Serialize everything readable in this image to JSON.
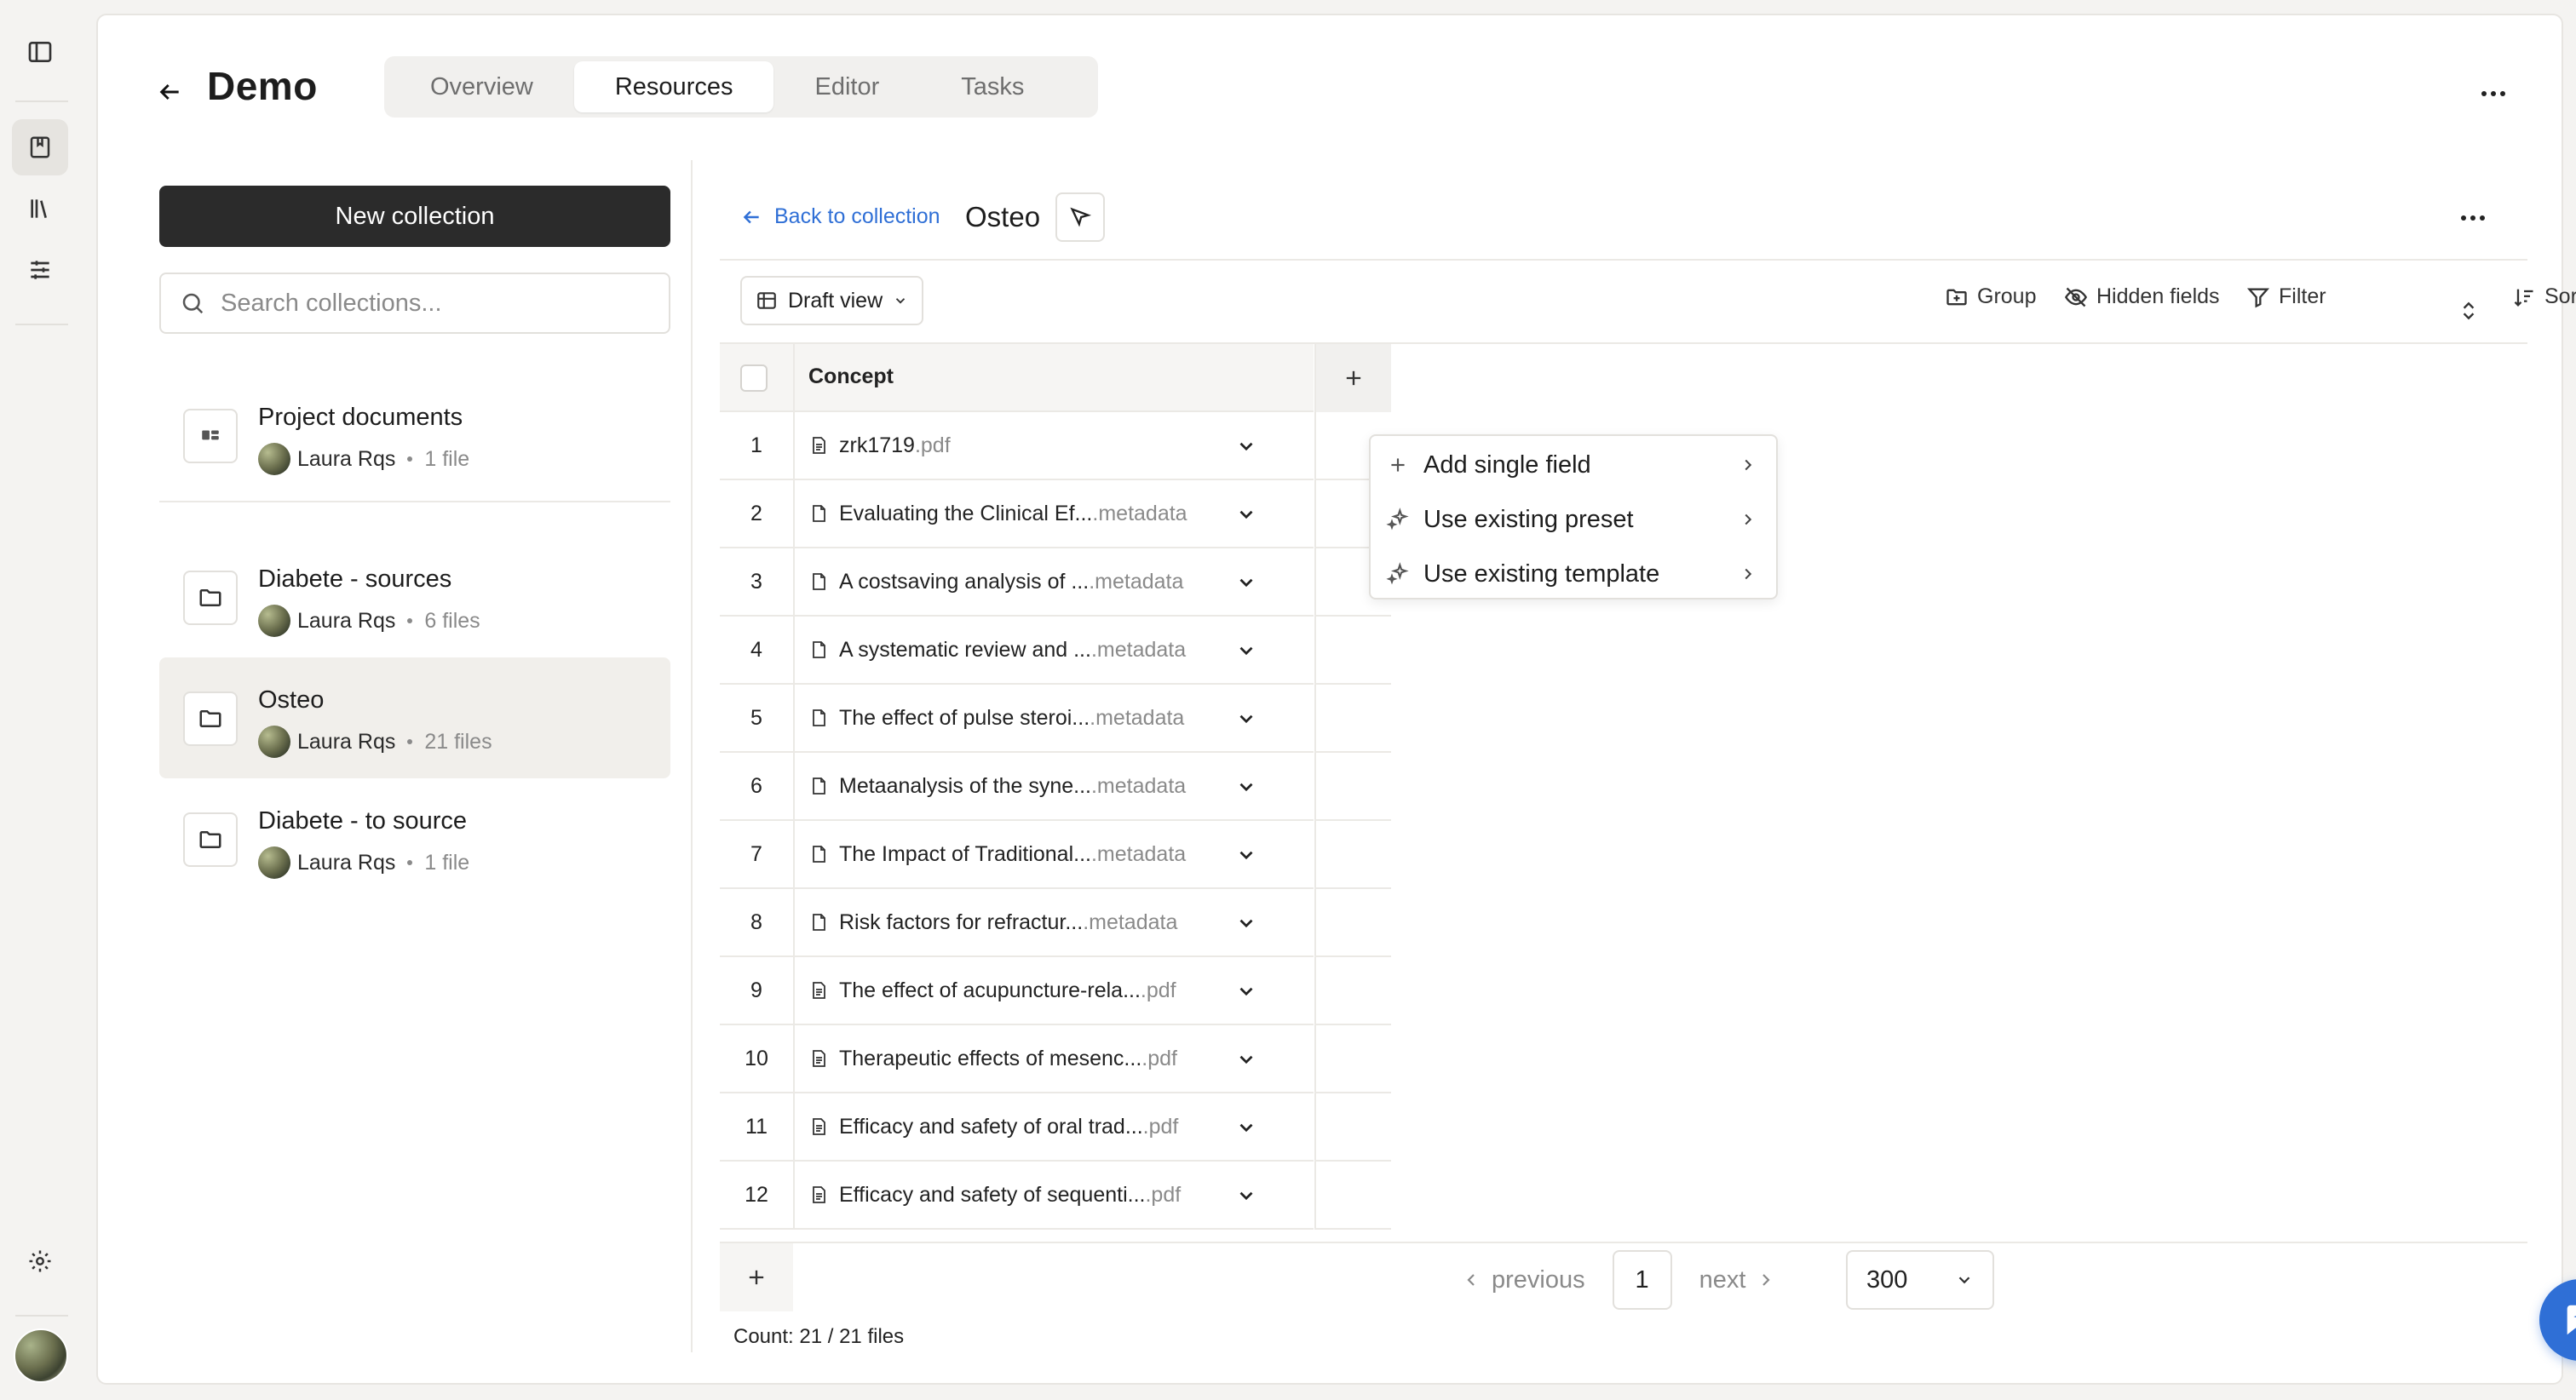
{
  "header": {
    "title": "Demo",
    "tabs": [
      "Overview",
      "Resources",
      "Editor",
      "Tasks"
    ],
    "active_tab": "Resources"
  },
  "sidebar": {
    "new_collection_label": "New collection",
    "search_placeholder": "Search collections..."
  },
  "collections": [
    {
      "name": "Project documents",
      "owner": "Laura Rqs",
      "files": "1 file",
      "icon": "project-icon",
      "selected": false
    },
    {
      "name": "Diabete - sources",
      "owner": "Laura Rqs",
      "files": "6 files",
      "icon": "folder-icon",
      "selected": false
    },
    {
      "name": "Osteo",
      "owner": "Laura Rqs",
      "files": "21 files",
      "icon": "folder-icon",
      "selected": true
    },
    {
      "name": "Diabete - to source",
      "owner": "Laura Rqs",
      "files": "1 file",
      "icon": "folder-icon",
      "selected": false
    }
  ],
  "panel": {
    "back_label": "Back to collection",
    "collection_title": "Osteo",
    "view_label": "Draft view",
    "toolbar": {
      "group": "Group",
      "hidden_fields": "Hidden fields",
      "filter": "Filter",
      "sort": "Sort"
    }
  },
  "table": {
    "column_header": "Concept",
    "rows": [
      {
        "n": "1",
        "title": "zrk1719",
        "ext": ".pdf",
        "kind": "pdf"
      },
      {
        "n": "2",
        "title": "Evaluating the Clinical Ef...",
        "ext": ".metadata",
        "kind": "meta"
      },
      {
        "n": "3",
        "title": "A costsaving analysis of ...",
        "ext": ".metadata",
        "kind": "meta"
      },
      {
        "n": "4",
        "title": "A systematic review and ...",
        "ext": ".metadata",
        "kind": "meta"
      },
      {
        "n": "5",
        "title": "The effect of pulse steroi...",
        "ext": ".metadata",
        "kind": "meta"
      },
      {
        "n": "6",
        "title": "Metaanalysis of the syne...",
        "ext": ".metadata",
        "kind": "meta"
      },
      {
        "n": "7",
        "title": "The Impact of Traditional...",
        "ext": ".metadata",
        "kind": "meta"
      },
      {
        "n": "8",
        "title": "Risk factors for refractur...",
        "ext": ".metadata",
        "kind": "meta"
      },
      {
        "n": "9",
        "title": "The effect of acupuncture-rela...",
        "ext": ".pdf",
        "kind": "pdf"
      },
      {
        "n": "10",
        "title": "Therapeutic effects of mesenc...",
        "ext": ".pdf",
        "kind": "pdf"
      },
      {
        "n": "11",
        "title": "Efficacy and safety of oral trad...",
        "ext": ".pdf",
        "kind": "pdf"
      },
      {
        "n": "12",
        "title": "Efficacy and safety of sequenti...",
        "ext": ".pdf",
        "kind": "pdf"
      }
    ],
    "count_label": "Count: 21 / 21 files"
  },
  "pagination": {
    "previous": "previous",
    "next": "next",
    "page": "1",
    "per_page": "300"
  },
  "add_field_menu": {
    "items": [
      "Add single field",
      "Use existing preset",
      "Use existing template"
    ]
  },
  "colors": {
    "accent": "#2f6fd6",
    "primary_button": "#2b2b2b",
    "selected_row": "#f1efeb"
  }
}
